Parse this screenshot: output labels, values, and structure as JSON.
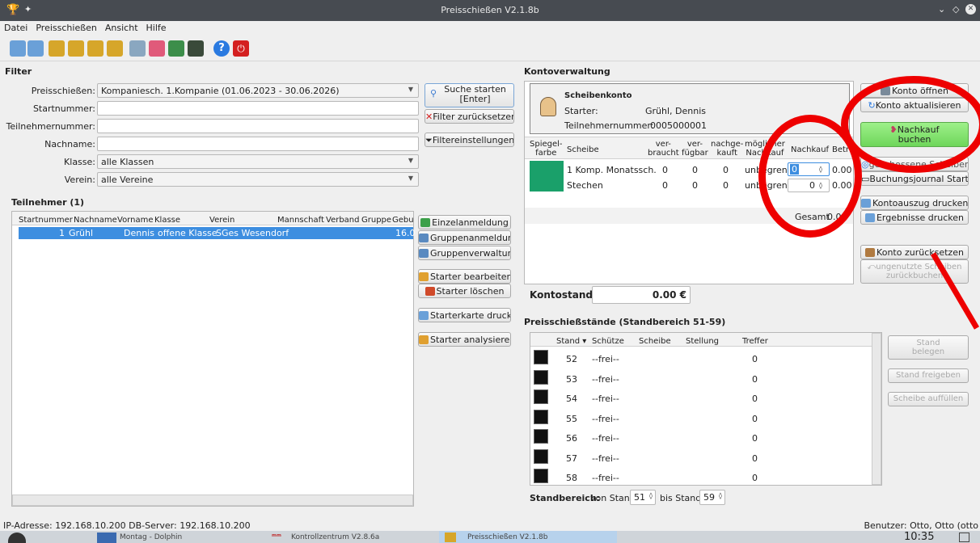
{
  "window": {
    "title": "Preisschießen V2.1.8b"
  },
  "menu": [
    "Datei",
    "Preisschießen",
    "Ansicht",
    "Hilfe"
  ],
  "filter": {
    "header": "Filter",
    "preisschiessen_label": "Preisschießen:",
    "preisschiessen_value": "Kompaniesch. 1.Kompanie (01.06.2023 - 30.06.2026)",
    "startnummer_label": "Startnummer:",
    "teilnehmernummer_label": "Teilnehmernummer:",
    "nachname_label": "Nachname:",
    "klasse_label": "Klasse:",
    "klasse_value": "alle Klassen",
    "verein_label": "Verein:",
    "verein_value": "alle Vereine",
    "suche_btn_l1": "Suche starten",
    "suche_btn_l2": "[Enter]",
    "reset_btn": "Filter zurücksetzen",
    "settings_btn": "Filtereinstellungen"
  },
  "participants": {
    "header": "Teilnehmer (1)",
    "columns": [
      "Startnummer",
      "Nachname",
      "Vorname",
      "Klasse",
      "Verein",
      "Mannschaft",
      "Verband",
      "Gruppe",
      "Gebu"
    ],
    "rows": [
      {
        "startnummer": "1",
        "nachname": "Grühl",
        "vorname": "Dennis",
        "klasse": "offene Klasse",
        "verein": "SGes Wesendorf",
        "geb": "16.0"
      }
    ],
    "buttons": [
      "Einzelanmeldung",
      "Gruppenanmeldung",
      "Gruppenverwaltung",
      "Starter bearbeiten",
      "Starter löschen",
      "Starterkarte drucken",
      "Starter analysieren"
    ]
  },
  "konto": {
    "header": "Kontoverwaltung",
    "card_title": "Scheibenkonto",
    "starter_label": "Starter:",
    "starter_value": "Grühl, Dennis",
    "tn_label": "Teilnehmernummer:",
    "tn_value": "0005000001",
    "col_spiegel_1": "Spiegel-",
    "col_spiegel_2": "farbe",
    "col_scheibe": "Scheibe",
    "col_verbraucht_1": "ver-",
    "col_verbraucht_2": "braucht",
    "col_verfuegbar_1": "ver-",
    "col_verfuegbar_2": "fügbar",
    "col_nachgekauft_1": "nachge-",
    "col_nachgekauft_2": "kauft",
    "col_moeglicher_1": "möglicher",
    "col_moeglicher_2": "Nachkauf",
    "col_nachkauf": "Nachkauf",
    "col_betrag": "Betr",
    "rows": [
      {
        "scheibe": "1 Komp. Monatssch.",
        "verbraucht": "0",
        "verfuegbar": "0",
        "nachgekauft": "0",
        "moeglich": "unbegrenzt",
        "nachkauf": "0",
        "betrag": "0.00"
      },
      {
        "scheibe": "Stechen",
        "verbraucht": "0",
        "verfuegbar": "0",
        "nachgekauft": "0",
        "moeglich": "unbegrenzt",
        "nachkauf": "0",
        "betrag": "0.00"
      }
    ],
    "gesamt_label": "Gesamt",
    "gesamt_value": "0.00",
    "kontostand_label": "Kontostand:",
    "kontostand_value": "0.00 €",
    "buttons": {
      "oeffnen": "Konto öffnen",
      "aktualisieren": "Konto aktualisieren",
      "nachkauf_l1": "Nachkauf",
      "nachkauf_l2": "buchen",
      "geschossene": "geschossene Scheiben",
      "journal": "Buchungsjournal Starter",
      "auszug": "Kontoauszug drucken",
      "ergebnisse": "Ergebnisse drucken",
      "zuruecksetzen": "Konto zurücksetzen",
      "ungenutzt_l1": "ungenutzte Scheiben",
      "ungenutzt_l2": "zurückbuchen"
    },
    "spiegel_color": "#1aa06a"
  },
  "stands": {
    "header": "Preisschießstände (Standbereich 51-59)",
    "columns": [
      "Stand",
      "Schütze",
      "Scheibe",
      "Stellung",
      "Treffer"
    ],
    "rows": [
      {
        "stand": "52",
        "schuetze": "--frei--",
        "treffer": "0"
      },
      {
        "stand": "53",
        "schuetze": "--frei--",
        "treffer": "0"
      },
      {
        "stand": "54",
        "schuetze": "--frei--",
        "treffer": "0"
      },
      {
        "stand": "55",
        "schuetze": "--frei--",
        "treffer": "0"
      },
      {
        "stand": "56",
        "schuetze": "--frei--",
        "treffer": "0"
      },
      {
        "stand": "57",
        "schuetze": "--frei--",
        "treffer": "0"
      },
      {
        "stand": "58",
        "schuetze": "--frei--",
        "treffer": "0"
      }
    ],
    "buttons": {
      "belegen_l1": "Stand",
      "belegen_l2": "belegen",
      "freigeben": "Stand freigeben",
      "auffuellen": "Scheibe auffüllen"
    },
    "range_label": "Standbereich:",
    "von_label": "von Stand",
    "von_value": "51",
    "bis_label": "bis Stand",
    "bis_value": "59"
  },
  "status": {
    "left": "IP-Adresse: 192.168.10.200 DB-Server: 192.168.10.200",
    "right": "Benutzer: Otto, Otto (otto"
  },
  "taskbar": {
    "item1": "Montag - Dolphin",
    "item2": "Kontrollzentrum V2.8.6a",
    "item3": "Preisschießen V2.1.8b",
    "clock": "10:35"
  }
}
